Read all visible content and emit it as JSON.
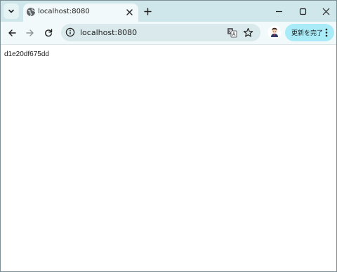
{
  "browser": {
    "tab": {
      "title": "localhost:8080",
      "favicon": "globe-icon"
    },
    "address_bar": {
      "url": "localhost:8080"
    },
    "update_button": {
      "label": "更新を完了"
    },
    "icons": {
      "tab_search": "chevron-down-icon",
      "tab_close": "close-icon",
      "new_tab": "plus-icon",
      "minimize": "minimize-icon",
      "maximize": "maximize-icon",
      "close_window": "close-icon",
      "back": "arrow-left-icon",
      "forward": "arrow-right-icon",
      "reload": "reload-icon",
      "site_info": "info-icon",
      "translate": "translate-icon",
      "bookmark": "star-icon",
      "profile": "avatar",
      "menu": "kebab-menu-icon"
    },
    "colors": {
      "tabstrip": "#cfe6ea",
      "active_tab": "#f2f9fa",
      "omnibox": "#d9e9ec",
      "update_button": "#a9ecf8"
    }
  },
  "page": {
    "text": "d1e20df675dd"
  }
}
